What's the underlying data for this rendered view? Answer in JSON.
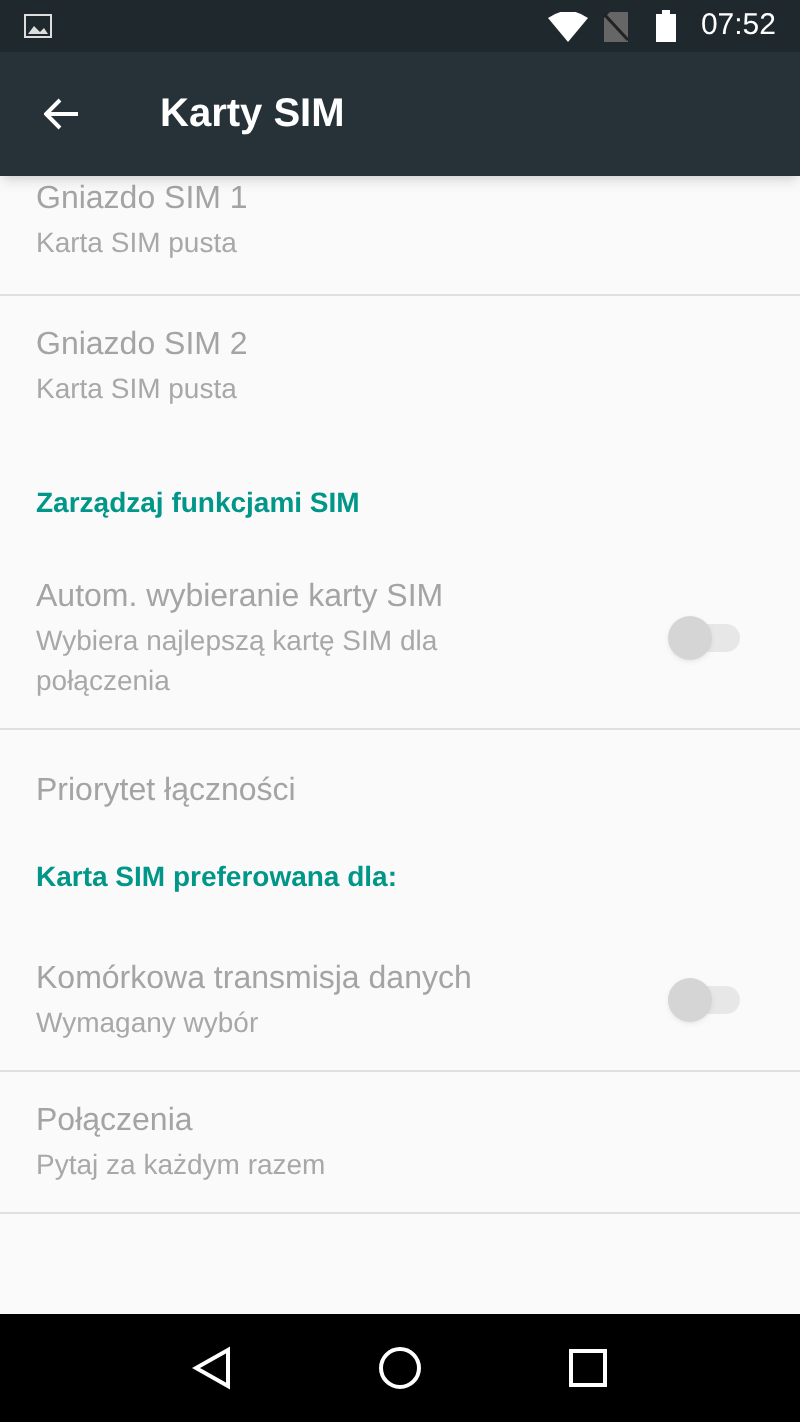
{
  "status_bar": {
    "time": "07:52"
  },
  "toolbar": {
    "title": "Karty SIM"
  },
  "items": [
    {
      "kind": "item",
      "title": "Gniazdo SIM 1",
      "subtitle": "Karta SIM pusta",
      "disabled": true
    },
    {
      "kind": "divider"
    },
    {
      "kind": "item",
      "title": "Gniazdo SIM 2",
      "subtitle": "Karta SIM pusta",
      "disabled": true
    },
    {
      "kind": "header",
      "title": "Zarządzaj funkcjami SIM"
    },
    {
      "kind": "switch",
      "title": "Autom. wybieranie karty SIM",
      "subtitle": "Wybiera najlepszą kartę SIM dla połączenia",
      "disabled": true,
      "on": false
    },
    {
      "kind": "divider"
    },
    {
      "kind": "item",
      "title": "Priorytet łączności",
      "disabled": true
    },
    {
      "kind": "header",
      "title": "Karta SIM preferowana dla:"
    },
    {
      "kind": "switch",
      "title": "Komórkowa transmisja danych",
      "subtitle": "Wymagany wybór",
      "disabled": true,
      "on": false
    },
    {
      "kind": "divider"
    },
    {
      "kind": "item",
      "title": "Połączenia",
      "subtitle": "Pytaj za każdym razem",
      "disabled": true
    },
    {
      "kind": "divider"
    }
  ]
}
